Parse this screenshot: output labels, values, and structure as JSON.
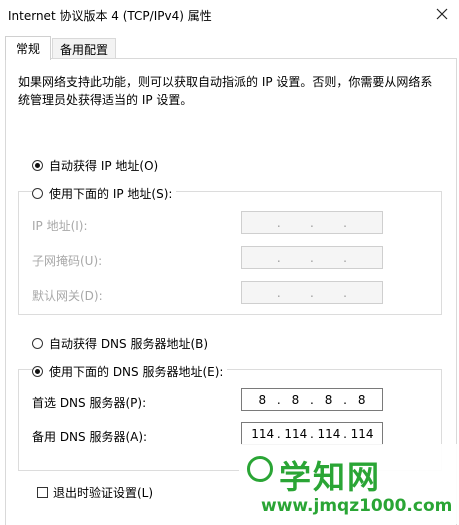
{
  "window": {
    "title": "Internet 协议版本 4 (TCP/IPv4) 属性"
  },
  "tabs": [
    "常规",
    "备用配置"
  ],
  "description": "如果网络支持此功能，则可以获取自动指派的 IP 设置。否则，你需要从网络系统管理员处获得适当的 IP 设置。",
  "ip": {
    "auto_label": "自动获得 IP 地址(O)",
    "manual_label": "使用下面的 IP 地址(S):",
    "mode": "auto",
    "fields": [
      {
        "label": "IP 地址(I):",
        "octets": [
          "",
          "",
          "",
          ""
        ]
      },
      {
        "label": "子网掩码(U):",
        "octets": [
          "",
          "",
          "",
          ""
        ]
      },
      {
        "label": "默认网关(D):",
        "octets": [
          "",
          "",
          "",
          ""
        ]
      }
    ]
  },
  "dns": {
    "auto_label": "自动获得 DNS 服务器地址(B)",
    "manual_label": "使用下面的 DNS 服务器地址(E):",
    "mode": "manual",
    "preferred_label": "首选 DNS 服务器(P):",
    "preferred": [
      "8",
      "8",
      "8",
      "8"
    ],
    "alternate_label": "备用 DNS 服务器(A):",
    "alternate": [
      "114",
      "114",
      "114",
      "114"
    ]
  },
  "validate_label": "退出时验证设置(L)",
  "validate_checked": false,
  "watermark": {
    "title": "学知网",
    "url": "www.jmqz1000.com"
  },
  "colors": {
    "watermark_green": "#2aa535"
  }
}
